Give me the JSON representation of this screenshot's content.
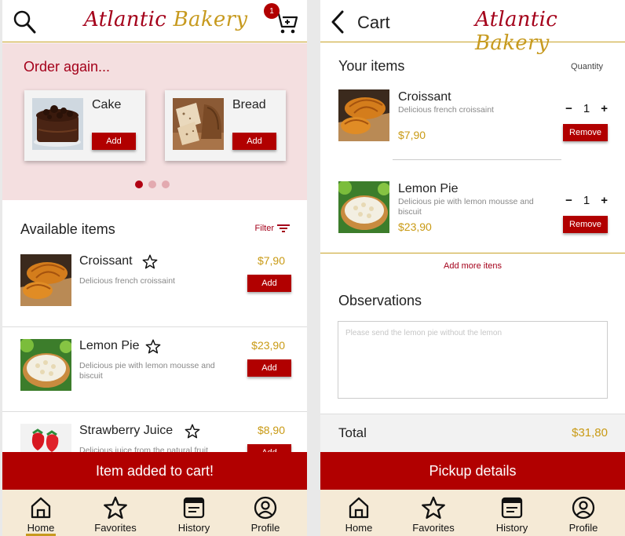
{
  "left": {
    "brand": {
      "part1": "Atlantic",
      "part2": "Bakery"
    },
    "cart_badge": "1",
    "order_again": {
      "title": "Order again...",
      "cards": [
        {
          "name": "Cake",
          "button": "Add",
          "image": "chocolate-cake-photo"
        },
        {
          "name": "Bread",
          "button": "Add",
          "image": "bread-photo"
        }
      ],
      "dots": 3,
      "active_dot": 0
    },
    "available": {
      "title": "Available items",
      "filter_label": "Filter",
      "items": [
        {
          "name": "Croissant",
          "desc": "Delicious french croissaint",
          "price": "$7,90",
          "button": "Add",
          "image": "croissant-photo"
        },
        {
          "name": "Lemon Pie",
          "desc": "Delicious pie with lemon mousse and biscuit",
          "price": "$23,90",
          "button": "Add",
          "image": "lemon-pie-photo"
        },
        {
          "name": "Strawberry Juice",
          "desc": "Delicious juice from the natural fruit",
          "price": "$8,90",
          "button": "Add",
          "image": "strawberry-photo"
        }
      ]
    },
    "toast": "Item added to cart!",
    "nav": [
      {
        "label": "Home",
        "icon": "home-icon",
        "active": true
      },
      {
        "label": "Favorites",
        "icon": "star-icon",
        "active": false
      },
      {
        "label": "History",
        "icon": "history-icon",
        "active": false
      },
      {
        "label": "Profile",
        "icon": "profile-icon",
        "active": false
      }
    ]
  },
  "right": {
    "title": "Cart",
    "brand": {
      "part1": "Atlantic",
      "part2": "Bakery"
    },
    "your_items_title": "Your items",
    "quantity_label": "Quantity",
    "items": [
      {
        "name": "Croissant",
        "desc": "Delicious french croissaint",
        "price": "$7,90",
        "qty": "1",
        "minus": "−",
        "plus": "+",
        "button": "Remove",
        "image": "croissant-photo"
      },
      {
        "name": "Lemon Pie",
        "desc": "Delicious pie with lemon mousse and biscuit",
        "price": "$23,90",
        "qty": "1",
        "minus": "−",
        "plus": "+",
        "button": "Remove",
        "image": "lemon-pie-photo"
      }
    ],
    "add_more": "Add more itens",
    "observations_title": "Observations",
    "observations_placeholder": "Please send the lemon pie without the lemon",
    "total_label": "Total",
    "total_value": "$31,80",
    "cta": "Pickup details",
    "nav": [
      {
        "label": "Home",
        "icon": "home-icon"
      },
      {
        "label": "Favorites",
        "icon": "star-icon"
      },
      {
        "label": "History",
        "icon": "history-icon"
      },
      {
        "label": "Profile",
        "icon": "profile-icon"
      }
    ]
  },
  "colors": {
    "brand_red": "#a4001a",
    "brand_gold": "#c79a1f",
    "button_red": "#b10000",
    "price_gold": "#c99a14",
    "pink_bg": "#f4dfe0",
    "nav_bg": "#f5ead6"
  }
}
